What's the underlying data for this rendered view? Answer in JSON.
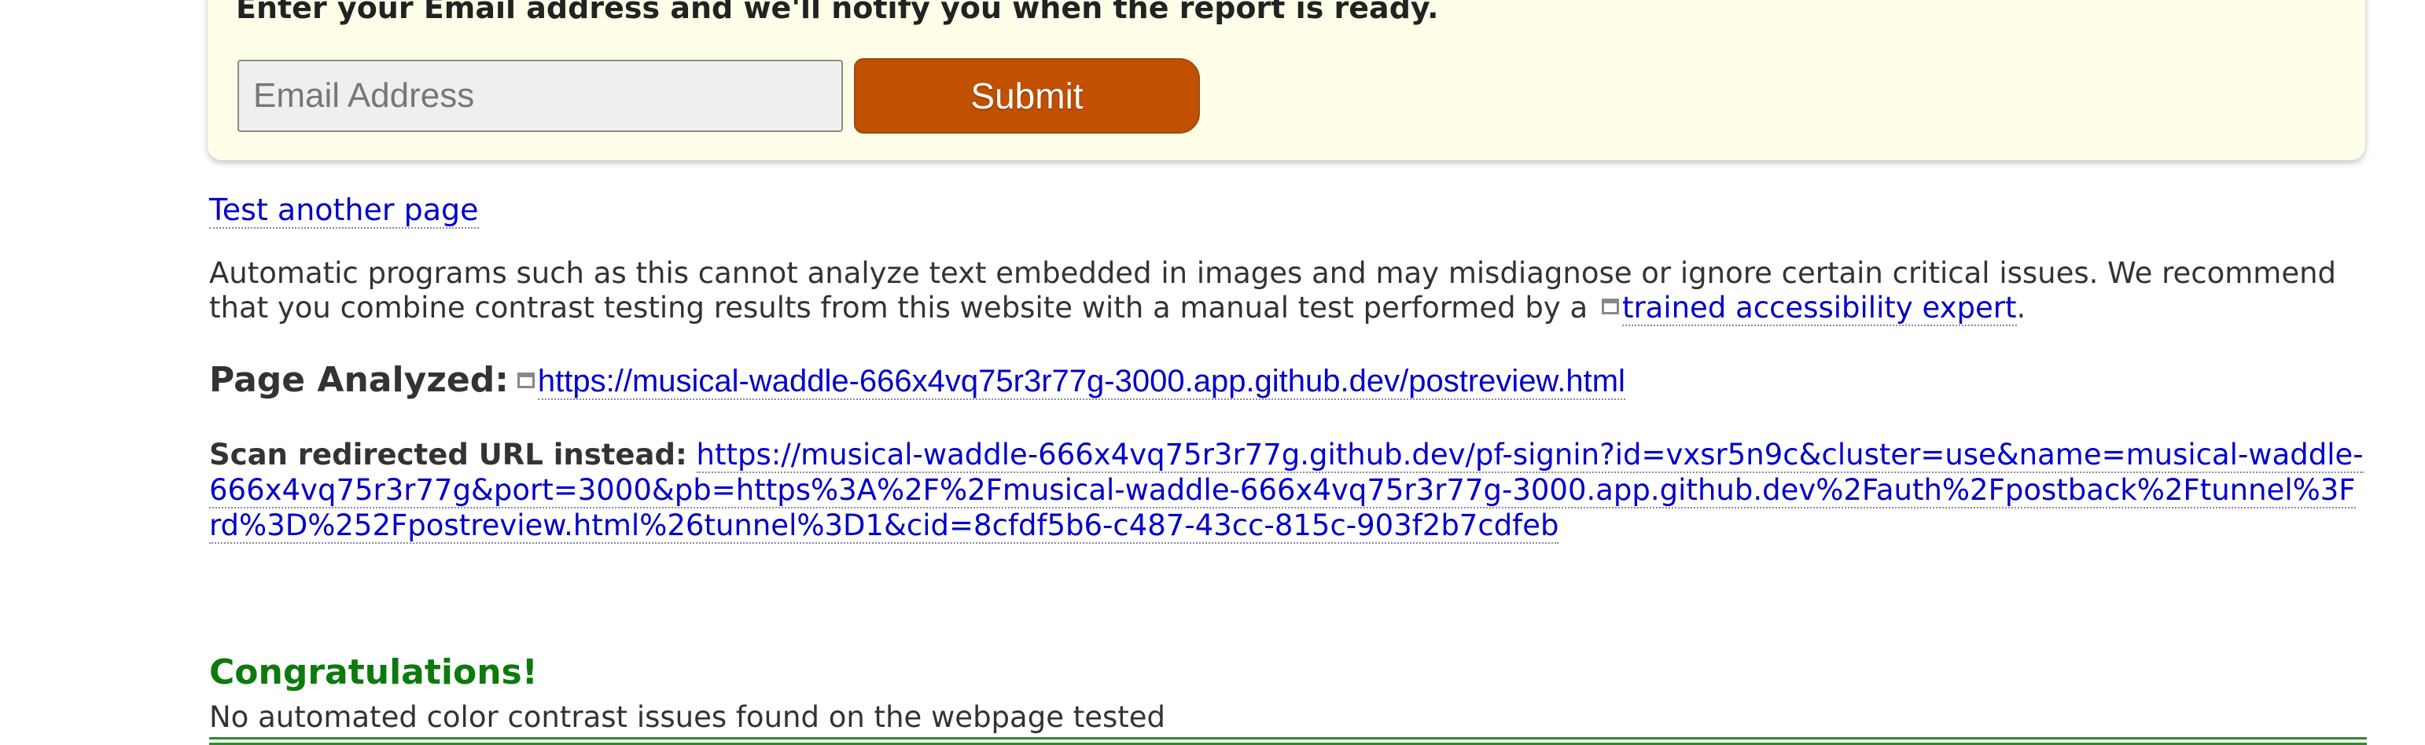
{
  "notify_form": {
    "message": "Enter your Email address and we'll notify you when the report is ready.",
    "email_placeholder": "Email Address",
    "email_value": "",
    "submit_label": "Submit"
  },
  "links": {
    "test_another": "Test another page"
  },
  "disclaimer": {
    "text": "Automatic programs such as this cannot analyze text embedded in images and may misdiagnose or ignore certain critical issues. We recommend that you combine contrast testing results from this website with a manual test performed by a ",
    "expert_link": "trained accessibility expert",
    "end": "."
  },
  "page_analyzed": {
    "label": "Page Analyzed:",
    "url": "https://musical-waddle-666x4vq75r3r77g-3000.app.github.dev/postreview.html"
  },
  "redirect": {
    "label": "Scan redirected URL instead:",
    "url": "https://musical-waddle-666x4vq75r3r77g.github.dev/pf-signin?id=vxsr5n9c&cluster=use&name=musical-waddle-666x4vq75r3r77g&port=3000&pb=https%3A%2F%2Fmusical-waddle-666x4vq75r3r77g-3000.app.github.dev%2Fauth%2Fpostback%2Ftunnel%3Frd%3D%252Fpostreview.html%26tunnel%3D1&cid=8cfdf5b6-c487-43cc-815c-903f2b7cdfeb"
  },
  "result": {
    "title": "Congratulations!",
    "message": "No automated color contrast issues found on the webpage tested"
  },
  "colors": {
    "submit": "#c15000",
    "card_background": "#fefee8",
    "link": "#0000cc",
    "success": "#0d7a0d"
  },
  "icons": {
    "external_link": "external-window-icon"
  }
}
